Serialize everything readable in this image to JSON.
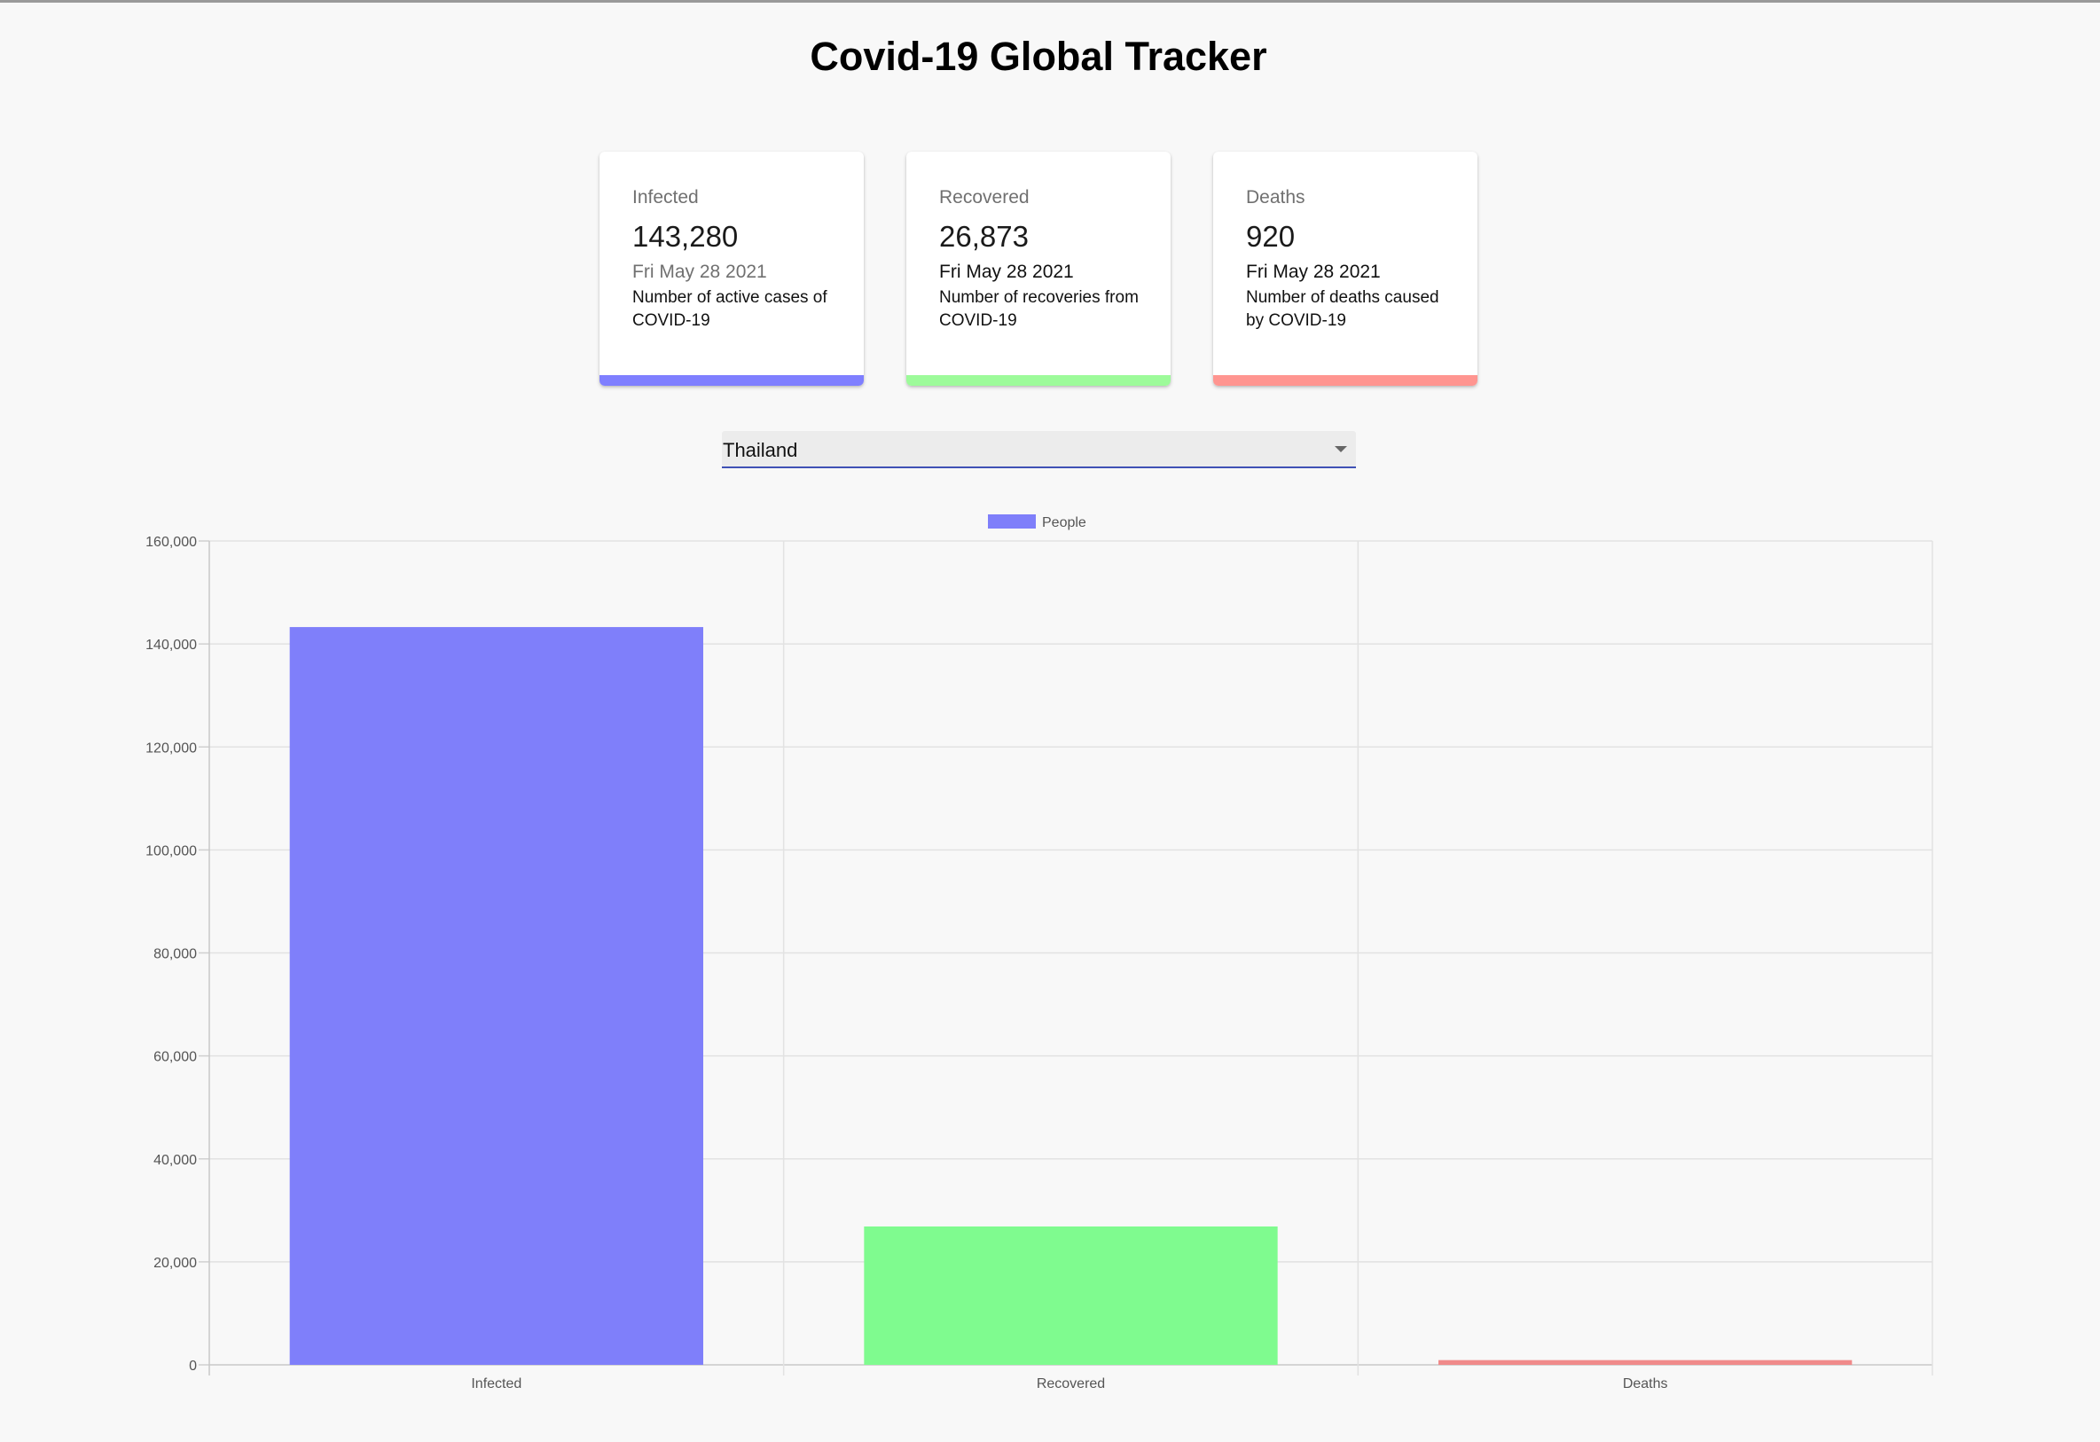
{
  "page": {
    "title": "Covid-19 Global Tracker"
  },
  "cards": [
    {
      "label": "Infected",
      "value": "143,280",
      "date": "Fri May 28 2021",
      "description": "Number of active cases of COVID-19",
      "color": "#7f7fff"
    },
    {
      "label": "Recovered",
      "value": "26,873",
      "date": "Fri May 28 2021",
      "description": "Number of recoveries from COVID-19",
      "color": "#9dfb9a"
    },
    {
      "label": "Deaths",
      "value": "920",
      "date": "Fri May 28 2021",
      "description": "Number of deaths caused by COVID-19",
      "color": "#ff9590"
    }
  ],
  "country_select": {
    "selected": "Thailand",
    "accent_color": "#3f51b5"
  },
  "chart_data": {
    "type": "bar",
    "categories": [
      "Infected",
      "Recovered",
      "Deaths"
    ],
    "series": [
      {
        "name": "People",
        "values": [
          143280,
          26873,
          920
        ],
        "colors": [
          "#7f7ffa",
          "#7ffb8f",
          "#f08a8a"
        ]
      }
    ],
    "legend": {
      "label": "People",
      "color": "#7f7ffa",
      "placement": "top-center"
    },
    "title": "",
    "xlabel": "",
    "ylabel": "",
    "ylim": [
      0,
      160000
    ],
    "yticks": [
      0,
      20000,
      40000,
      60000,
      80000,
      100000,
      120000,
      140000,
      160000
    ],
    "ytick_labels": [
      "0",
      "20,000",
      "40,000",
      "60,000",
      "80,000",
      "100,000",
      "120,000",
      "140,000",
      "160,000"
    ],
    "grid": true
  }
}
